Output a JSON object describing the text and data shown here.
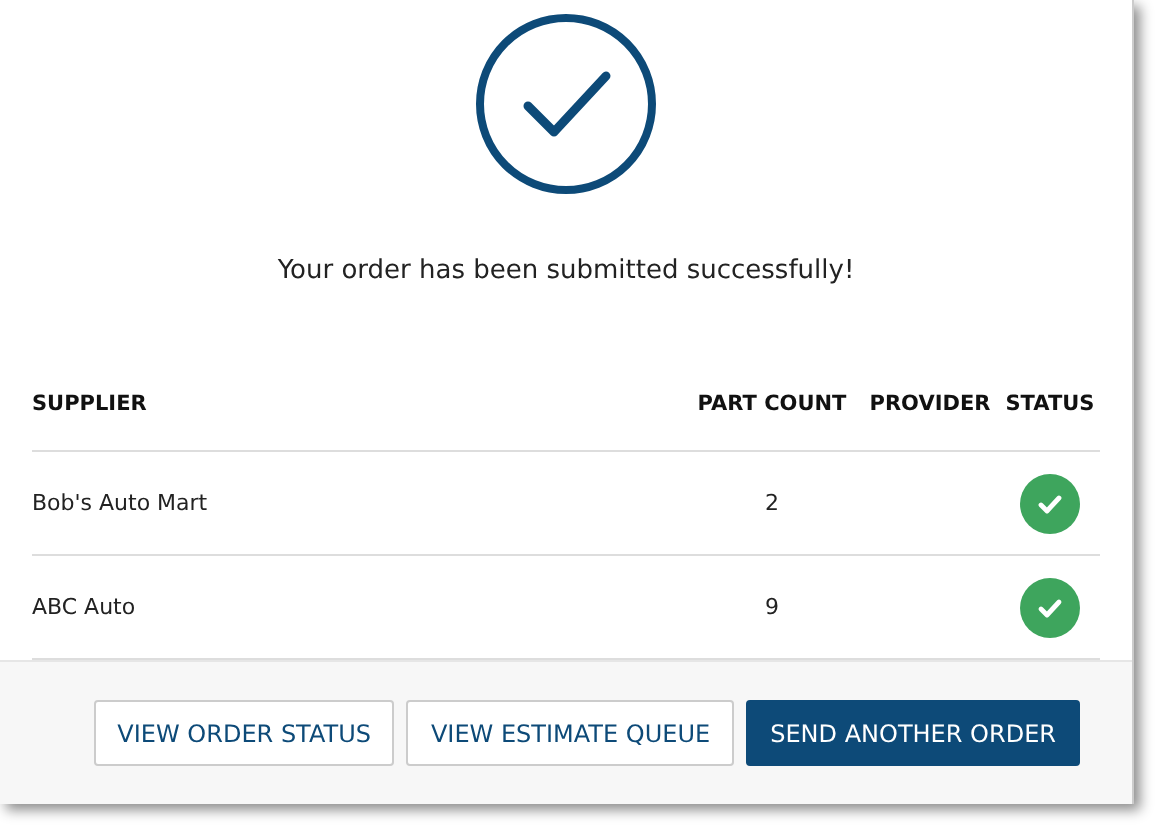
{
  "message": "Your order has been submitted successfully!",
  "table": {
    "columns": [
      "SUPPLIER",
      "PART COUNT",
      "PROVIDER",
      "STATUS"
    ],
    "rows": [
      {
        "supplier": "Bob's Auto Mart",
        "part_count": "2",
        "completed": true
      },
      {
        "supplier": "ABC Auto",
        "part_count": "9",
        "completed": true
      }
    ]
  },
  "buttons": [
    {
      "label": "VIEW ORDER STATUS",
      "kind": "secondary"
    },
    {
      "label": "VIEW ESTIMATE QUEUE",
      "kind": "secondary"
    },
    {
      "label": "SEND ANOTHER ORDER",
      "kind": "primary"
    }
  ]
}
